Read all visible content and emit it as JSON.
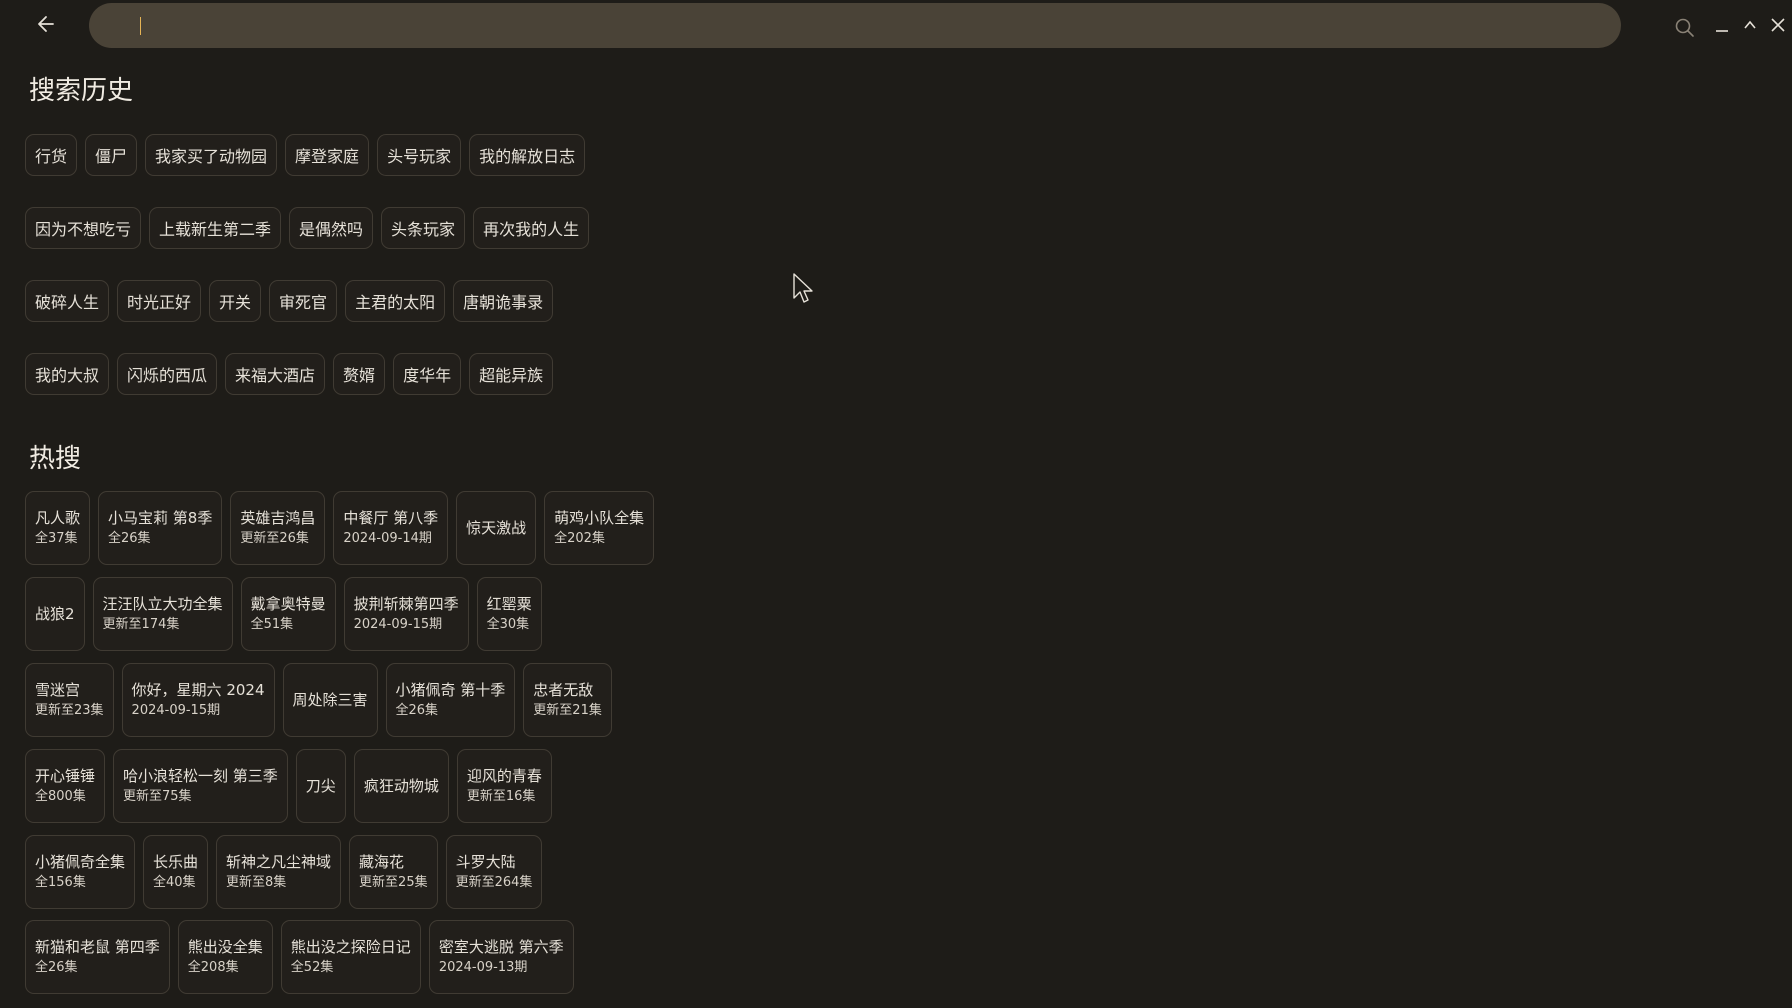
{
  "search": {
    "placeholder": "",
    "value": ""
  },
  "sections": {
    "history_title": "搜索历史",
    "hot_title": "热搜"
  },
  "history_rows": [
    [
      "行货",
      "僵尸",
      "我家买了动物园",
      "摩登家庭",
      "头号玩家",
      "我的解放日志"
    ],
    [
      "因为不想吃亏",
      "上载新生第二季",
      "是偶然吗",
      "头条玩家",
      "再次我的人生"
    ],
    [
      "破碎人生",
      "时光正好",
      "开关",
      "审死官",
      "主君的太阳",
      "唐朝诡事录"
    ],
    [
      "我的大叔",
      "闪烁的西瓜",
      "来福大酒店",
      "赘婿",
      "度华年",
      "超能异族"
    ]
  ],
  "hot_rows": [
    [
      {
        "title": "凡人歌",
        "sub": "全37集"
      },
      {
        "title": "小马宝莉 第8季",
        "sub": "全26集"
      },
      {
        "title": "英雄吉鸿昌",
        "sub": "更新至26集"
      },
      {
        "title": "中餐厅 第八季",
        "sub": "2024-09-14期"
      },
      {
        "title": "惊天激战",
        "sub": ""
      },
      {
        "title": "萌鸡小队全集",
        "sub": "全202集"
      }
    ],
    [
      {
        "title": "战狼2",
        "sub": ""
      },
      {
        "title": "汪汪队立大功全集",
        "sub": "更新至174集"
      },
      {
        "title": "戴拿奥特曼",
        "sub": "全51集"
      },
      {
        "title": "披荆斩棘第四季",
        "sub": "2024-09-15期"
      },
      {
        "title": "红罂粟",
        "sub": "全30集"
      }
    ],
    [
      {
        "title": "雪迷宫",
        "sub": "更新至23集"
      },
      {
        "title": "你好，星期六 2024",
        "sub": "2024-09-15期"
      },
      {
        "title": "周处除三害",
        "sub": ""
      },
      {
        "title": "小猪佩奇 第十季",
        "sub": "全26集"
      },
      {
        "title": "忠者无敌",
        "sub": "更新至21集"
      }
    ],
    [
      {
        "title": "开心锤锤",
        "sub": "全800集"
      },
      {
        "title": "哈小浪轻松一刻 第三季",
        "sub": "更新至75集"
      },
      {
        "title": "刀尖",
        "sub": ""
      },
      {
        "title": "疯狂动物城",
        "sub": ""
      },
      {
        "title": "迎风的青春",
        "sub": "更新至16集"
      }
    ],
    [
      {
        "title": "小猪佩奇全集",
        "sub": "全156集"
      },
      {
        "title": "长乐曲",
        "sub": "全40集"
      },
      {
        "title": "斩神之凡尘神域",
        "sub": "更新至8集"
      },
      {
        "title": "藏海花",
        "sub": "更新至25集"
      },
      {
        "title": "斗罗大陆",
        "sub": "更新至264集"
      }
    ],
    [
      {
        "title": "新猫和老鼠 第四季",
        "sub": "全26集"
      },
      {
        "title": "熊出没全集",
        "sub": "全208集"
      },
      {
        "title": "熊出没之探险日记",
        "sub": "全52集"
      },
      {
        "title": "密室大逃脱 第六季",
        "sub": "2024-09-13期"
      }
    ]
  ],
  "colors": {
    "background": "#1e1c18",
    "search_bar": "#4a4337",
    "chip_border": "#403b33",
    "caret": "#e6b455"
  }
}
